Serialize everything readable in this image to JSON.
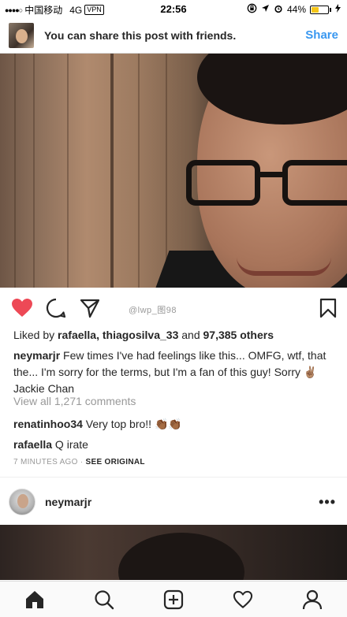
{
  "status_bar": {
    "signal": "●●●●○",
    "carrier": "中国移动",
    "network": "4G",
    "vpn": "VPN",
    "time": "22:56",
    "battery": "44%",
    "battery_level": 0.44
  },
  "share_banner": {
    "text": "You can share this post with friends.",
    "action": "Share"
  },
  "watermark": "@lwp_图98",
  "post": {
    "liked_prefix": "Liked by ",
    "liked_users": "rafaella, thiagosilva_33",
    "liked_and": " and ",
    "liked_count": "97,385 others",
    "caption_user": "neymarjr",
    "caption_text": " Few times I've had feelings like this... OMFG, wtf, that the... I'm sorry for the terms, but I'm a fan of this guy! Sorry ✌🏽 Jackie Chan",
    "view_all": "View all 1,271 comments",
    "comments": [
      {
        "user": "renatinhoo34",
        "text": " Very top bro!! 👏🏾👏🏾"
      },
      {
        "user": "rafaella",
        "text": " Q irate"
      }
    ],
    "time_ago": "7 MINUTES AGO",
    "separator": " · ",
    "see_original": "SEE ORIGINAL"
  },
  "next_post": {
    "username": "neymarjr",
    "more": "•••"
  },
  "icons": {
    "like": "heart-filled-icon",
    "comment": "comment-icon",
    "share": "direct-share-icon",
    "save": "bookmark-icon",
    "home": "home-icon",
    "search": "search-icon",
    "add": "add-post-icon",
    "activity": "heart-outline-icon",
    "profile": "profile-icon"
  },
  "colors": {
    "accent": "#3897f0",
    "like": "#ed4956",
    "text": "#262626",
    "muted": "#999999"
  }
}
